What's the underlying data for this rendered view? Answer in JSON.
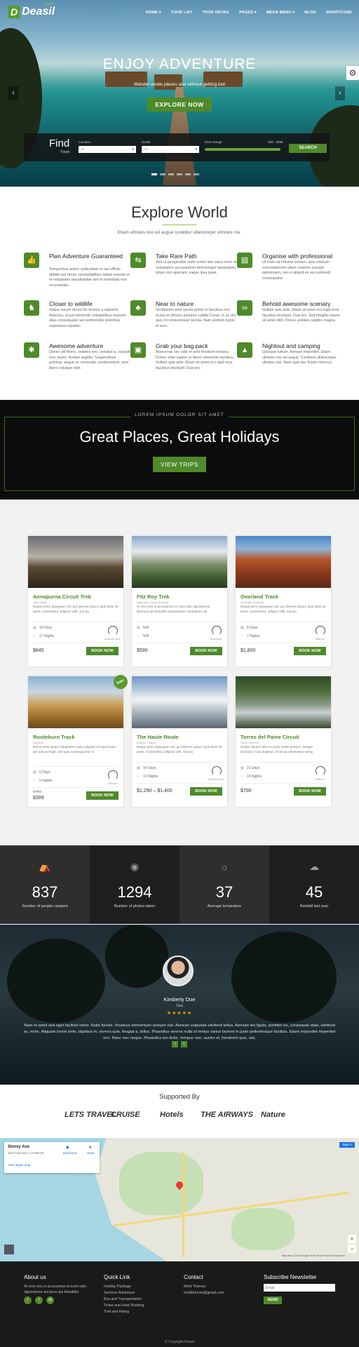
{
  "brand": {
    "name": "Deasil",
    "mark": "D",
    "tag": "Travel"
  },
  "nav": [
    "HOME ▾",
    "TOUR LIST",
    "TOUR DETAIL",
    "PAGES ▾",
    "MEGA MENU ▾",
    "BLOG",
    "SHORTCODE"
  ],
  "hero": {
    "title": "ENJOY ADVENTURE",
    "subtitle": "Wander exotic places and without getting lost",
    "button": "EXPLORE NOW"
  },
  "search": {
    "find": "Find",
    "tours": "Tours",
    "location_label": "Location",
    "location_value": "All",
    "grade_label": "Grade",
    "grade_value": "All",
    "price_label": "Price Range",
    "price_value": "399 - 2099",
    "button": "SEARCH"
  },
  "explore": {
    "title": "Explore World",
    "subtitle": "Etiam ultricies nisi vel augue curabitur ullamcorper ultricies nisi.",
    "features": [
      {
        "title": "Plan Adventure Guaranteed",
        "desc": "Temporibus autem quibusdam et aut officiis debitis aut rerum necessitatibus saepe eveniet ut et voluptates repudiandae sint et molestiae non recusandae.",
        "icon": "thumbs-up-icon"
      },
      {
        "title": "Take Rare Path",
        "desc": "Sed ut perspiciatis unde omnis iste natus error sit voluptatem accusantium doloremque laudantium, totam rem aperiam, eaque ipsa quae.",
        "icon": "signpost-icon"
      },
      {
        "title": "Organise with professional",
        "desc": "Ut enim ad minima veniam, quis nostrum exercitationem ullam corporis suscipit laboriosam, nisi ut aliquid ex ea commodi consequatur.",
        "icon": "map-icon"
      },
      {
        "title": "Closer to wildlife",
        "desc": "Itaque earum rerum hic tenetur a sapiente delectus, ut aut reiciendis voluptatibus maiores alias consequatur aut perferendis doloribus asperiores repellat.",
        "icon": "deer-icon"
      },
      {
        "title": "Near to nature",
        "desc": "Vestibulum ante ipsum primis in faucibus orci luctus et ultrices posuere cubilia Curae; In ac dui quis mi consectetuer lacinia. Nam pretium turpis et arcu.",
        "icon": "tree-icon"
      },
      {
        "title": "Behold awesome scenary",
        "desc": "Nullam quis ante. Etiam sit amet orci eget eros faucibus tincidunt. Duis leo. Sed fringilla mauris sit amet nibh. Donec sodales sagittis magna.",
        "icon": "binoculars-icon"
      },
      {
        "title": "Awesome adventure",
        "desc": "Donec elit libero, sodales nec, volutpat a, suscipit non, turpis. Nullam sagittis. Suspendisse pulvinar, augue ac venenatis condimentum, sem libero volutpat nibh.",
        "icon": "hiker-icon"
      },
      {
        "title": "Grab your bag pack",
        "desc": "Maecenas nec odio et ante tincidunt tempus. Donec vitae sapien ut libero venenatis faucibus. Nullam quis ante. Etiam sit amet orci eget eros faucibus tincidunt. Duis leo.",
        "icon": "backpack-icon"
      },
      {
        "title": "Nightout and camping",
        "desc": "Quisque rutrum. Aenean imperdiet. Etiam ultricies nisi vel augue. Curabitur ullamcorper ultricies nisi. Nam eget dui. Etiam rhoncus.",
        "icon": "tent-icon"
      }
    ]
  },
  "banner": {
    "label": "LOREM IPSUM DOLOR SIT AMET",
    "title": "Great Places, Great Holidays",
    "button": "VIEW TRIPS"
  },
  "trips": [
    {
      "name": "Annapurna Circuit Trek",
      "loc": "Gold Nepal",
      "desc": "Neque porro quisquam est, qui dolorem ipsum quia dolor sit amet, consectetur, adipisci velit, sed qu",
      "days": "18 Days",
      "nights": "17 Nights",
      "grade": "Adventurous",
      "price": "$845",
      "old": "",
      "book": "BOOK NOW"
    },
    {
      "name": "Fitz Roy Trek",
      "loc": "Argentina, South America",
      "desc": "At vero eos et accusamus et iusto odio dignissimos ducimus qui blanditiis praesentium voluptatum de",
      "days": "N/A",
      "nights": "N/A",
      "grade": "Moderate",
      "price": "$590",
      "old": "",
      "book": "BOOK NOW"
    },
    {
      "name": "Overland Track",
      "loc": "Australia, Oceania",
      "desc": "Neque porro quisquam est, qui dolorem ipsum quia dolor sit amet, consectetur, adipisci velit, sed qu",
      "days": "8 Days",
      "nights": "7 Nights",
      "grade": "Difficult",
      "price": "$1,800",
      "old": "",
      "book": "BOOK NOW"
    },
    {
      "name": "Routeburn Track",
      "loc": "Oceania",
      "desc": "Nemo enim ipsam voluptatem quia voluptas sit aspernatur aut odit aut fugit, sed quia consequuntur m",
      "days": "6 Days",
      "nights": "5 Nights",
      "grade": "Difficult",
      "price": "$399",
      "old": "$450",
      "book": "BOOK NOW"
    },
    {
      "name": "The Haute Route",
      "loc": "Europe, France",
      "desc": "Neque porro quisquam est, qui dolorem ipsum quia dolor sit amet, consectetur, adipisci velit, sed qu",
      "days": "14 Days",
      "nights": "13 Nights",
      "grade": "Adventurous",
      "price": "$1,290 – $1,400",
      "old": "",
      "book": "BOOK NOW"
    },
    {
      "name": "Torres del Paine Circuit",
      "loc": "South America",
      "desc": "Nullam dictum felis eu pede mollis pretium. Integer tincidunt. Cras dapibus. Vivamus elementum semp",
      "days": "21 Days",
      "nights": "19 Nights",
      "grade": "Difficult",
      "price": "$700",
      "old": "",
      "book": "BOOK NOW"
    }
  ],
  "sale_badge": "Sale!",
  "stats": [
    {
      "value": "837",
      "label": "Number of people camped",
      "icon": "tent-icon"
    },
    {
      "value": "1294",
      "label": "Number of photos taken",
      "icon": "camera-icon"
    },
    {
      "value": "37",
      "label": "Average temprature",
      "icon": "sun-icon"
    },
    {
      "value": "45",
      "label": "Rainfall last year",
      "icon": "rain-icon"
    }
  ],
  "testimonial": {
    "name": "Kimberly Doe",
    "role": "Ceo",
    "stars": "★★★★★",
    "quote": "Nam et amet sed eget facilisis tortor. Nulla facilisi. Vivamus elementum semper nisi. Aenean vulputate eleifend tellus. Aenean leo ligula, porttitor eu, consequat vitae, eleifend ac, enim. Aliquam lorem ante, dapibus in, viverra quis, feugiat a, tellus. Phasellus viverra nulla ut metus varius laoreet in justo pellentesque facilisis. Etiam imperdiet imperdiet orci. Nunc nec neque. Phasellus leo dolor, tempus non, auctor et, hendrerit quis, nisi."
  },
  "supported": {
    "title": "Supported By",
    "brands": [
      "LETS TRAVEL",
      "CRUISE",
      "Hotels",
      "THE AIRWAYS",
      "Nature"
    ]
  },
  "map": {
    "place": "Storey Ave",
    "addr": "San Francisco, CA 94129",
    "directions": "Directions",
    "save": "Save",
    "larger": "View larger map",
    "signin": "Sign in",
    "footer": "Map data ©2018 Google  Terms of Use  Report a map error"
  },
  "footer": {
    "about_title": "About us",
    "about_text": "At vero eos et accusamus et iusto odio dignissimos ducimus qui blanditiis.",
    "quick_title": "Quick Link",
    "quick": [
      "Holiday Package",
      "Summer Adventure",
      "Bus and Transportation",
      "Ticket and Hotel Booking",
      "Trek and Hiking"
    ],
    "contact_title": "Contact",
    "contact": [
      "Mold Themes",
      "moldthemes@gmail.com"
    ],
    "news_title": "Subscribe Newsletter",
    "news_placeholder": "Email",
    "news_button": "SEND",
    "copyright": "© Copyright Deasil"
  }
}
